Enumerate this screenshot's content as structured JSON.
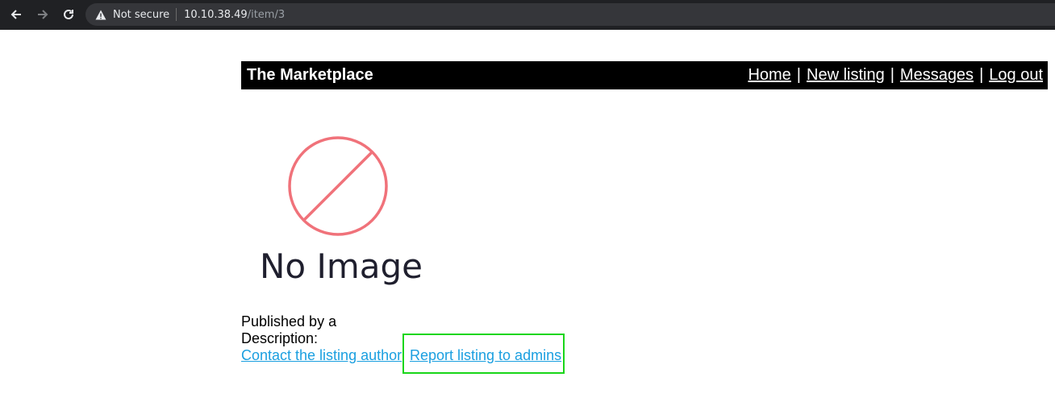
{
  "browser": {
    "security_label": "Not secure",
    "url_host": "10.10.38.49",
    "url_path": "/item/3"
  },
  "site": {
    "title": "The Marketplace",
    "nav": {
      "home": "Home",
      "new_listing": "New listing",
      "messages": "Messages",
      "log_out": "Log out",
      "separator": "|"
    }
  },
  "listing": {
    "image_text": "No Image",
    "published_by": "Published by a",
    "description": "Description:",
    "contact_link": "Contact the listing author",
    "report_link": "Report listing to admins"
  },
  "colors": {
    "chrome_bg": "#202124",
    "omnibox_bg": "#35363a",
    "header_bg": "#000000",
    "link": "#1a9fe0",
    "highlight": "#19d619",
    "no_image_circle": "#f0727a"
  },
  "icons": [
    "back-arrow-icon",
    "forward-arrow-icon",
    "reload-icon",
    "warning-icon",
    "no-image-icon"
  ]
}
